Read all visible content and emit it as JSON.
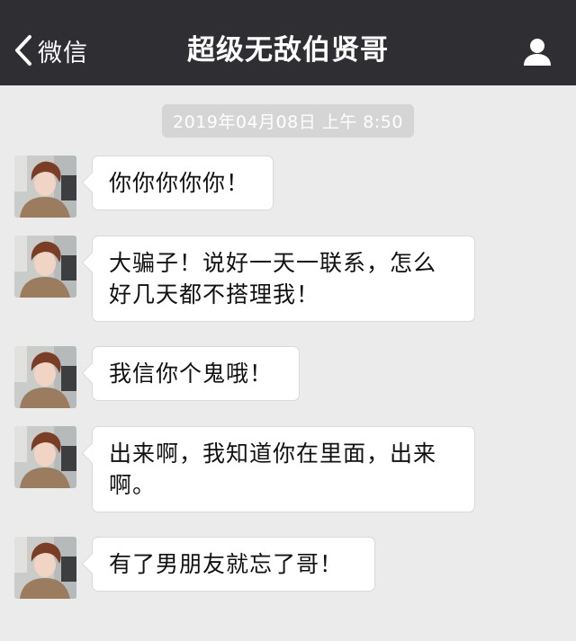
{
  "header": {
    "back_label": "微信",
    "title": "超级无敌伯贤哥",
    "profile_icon": "person-icon"
  },
  "timestamp": "2019年04月08日 上午 8:50",
  "messages": [
    {
      "text": "你你你你你！"
    },
    {
      "text": "大骗子！说好一天一联系，怎么好几天都不搭理我！"
    },
    {
      "text": "我信你个鬼哦！"
    },
    {
      "text": "出来啊，我知道你在里面，出来啊。"
    },
    {
      "text": "有了男朋友就忘了哥！"
    }
  ],
  "colors": {
    "navbar_bg": "#2e2e33",
    "chat_bg": "#ebebeb",
    "bubble_bg": "#ffffff",
    "timestamp_bg": "#d5d5d5"
  }
}
